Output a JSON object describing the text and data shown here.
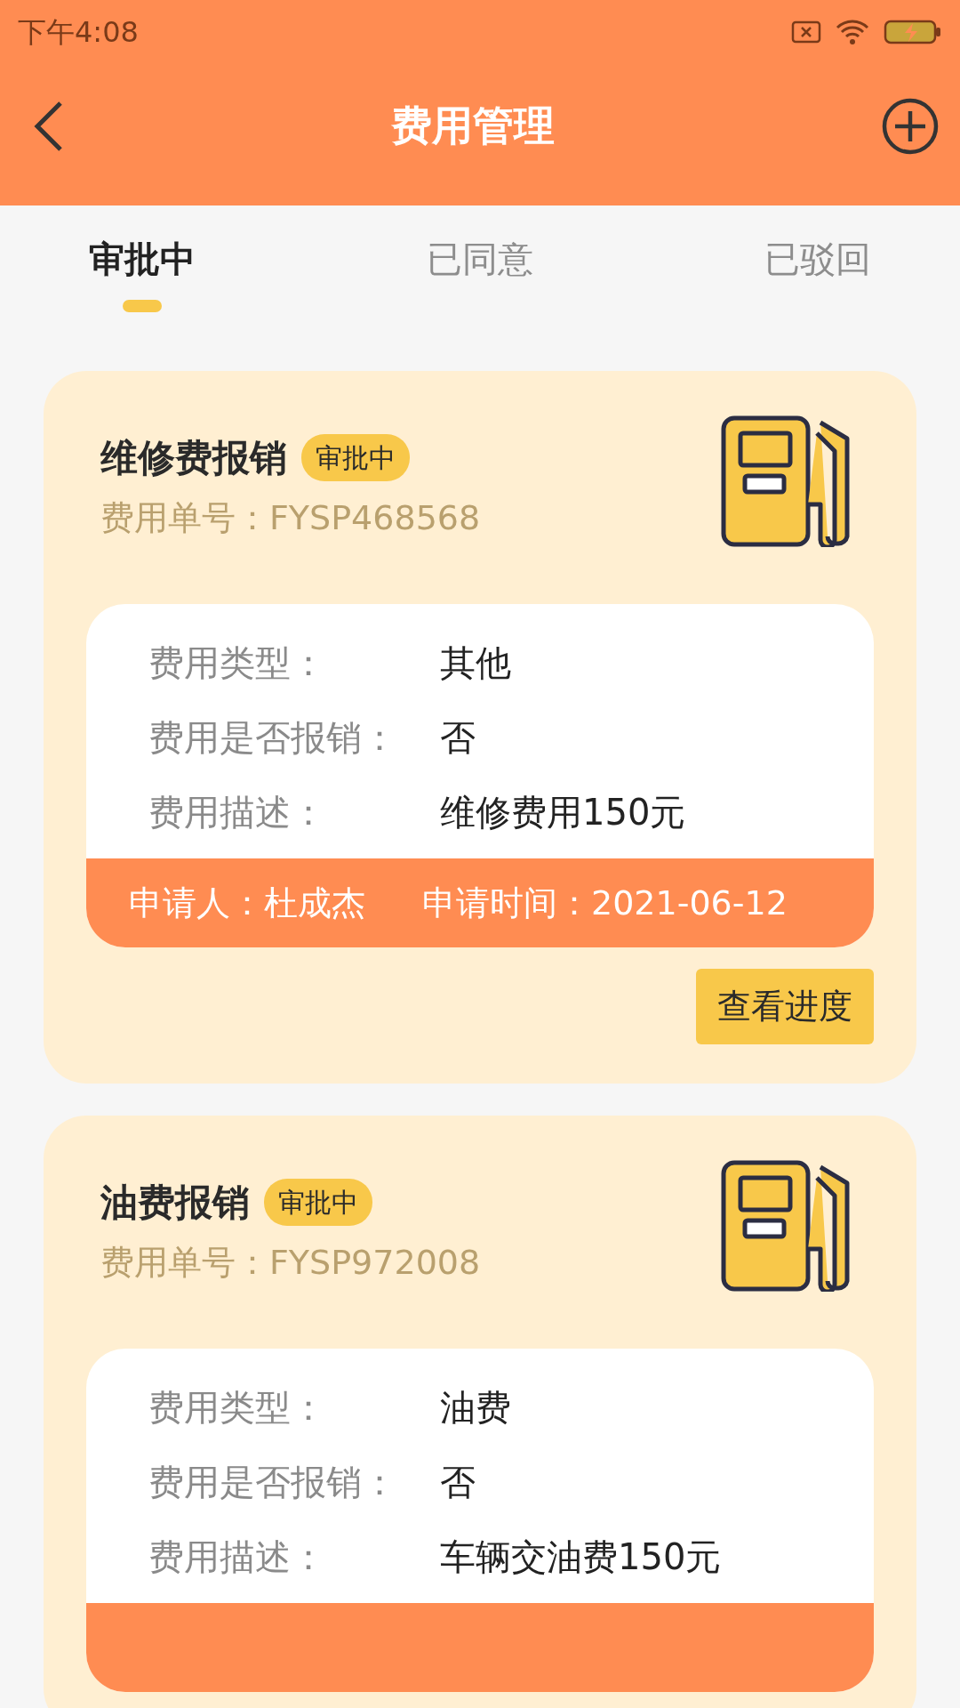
{
  "status_bar": {
    "time": "下午4:08"
  },
  "header": {
    "title": "费用管理"
  },
  "tabs": [
    {
      "label": "审批中",
      "selected": true
    },
    {
      "label": "已同意",
      "selected": false
    },
    {
      "label": "已驳回",
      "selected": false
    }
  ],
  "cards": [
    {
      "title": "维修费报销",
      "badge": "审批中",
      "number": "费用单号：FYSP468568",
      "fields": [
        {
          "label": "费用类型：",
          "value": "其他"
        },
        {
          "label": "费用是否报销：",
          "value": "否"
        },
        {
          "label": "费用描述：",
          "value": "维修费用150元"
        }
      ],
      "applicant": "申请人：杜成杰",
      "time": "申请时间：2021-06-12",
      "button": "查看进度"
    },
    {
      "title": "油费报销",
      "badge": "审批中",
      "number": "费用单号：FYSP972008",
      "fields": [
        {
          "label": "费用类型：",
          "value": "油费"
        },
        {
          "label": "费用是否报销：",
          "value": "否"
        },
        {
          "label": "费用描述：",
          "value": "车辆交油费150元"
        }
      ]
    }
  ]
}
